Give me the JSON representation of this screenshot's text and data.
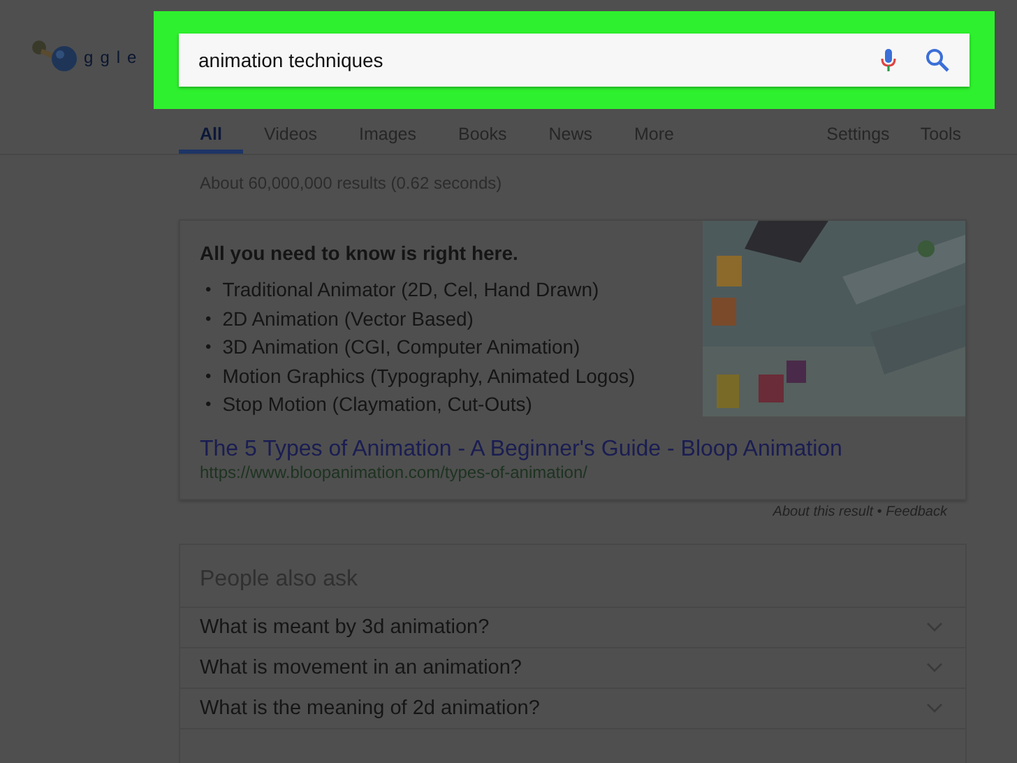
{
  "logo": {
    "letters": [
      "g",
      "g",
      "l",
      "e"
    ]
  },
  "search": {
    "value": "animation techniques",
    "highlighted": true
  },
  "tabs": [
    {
      "label": "All",
      "selected": true
    },
    {
      "label": "Videos",
      "selected": false
    },
    {
      "label": "Images",
      "selected": false
    },
    {
      "label": "Books",
      "selected": false
    },
    {
      "label": "News",
      "selected": false
    },
    {
      "label": "More",
      "selected": false
    }
  ],
  "tools": [
    "Settings",
    "Tools"
  ],
  "result_stats": "About 60,000,000 results (0.62 seconds)",
  "featured": {
    "heading": "All you need to know is right here.",
    "bullet": "•",
    "items": [
      "Traditional Animator (2D, Cel, Hand Drawn)",
      "2D Animation (Vector Based)",
      "3D Animation (CGI, Computer Animation)",
      "Motion Graphics (Typography, Animated Logos)",
      "Stop Motion (Claymation, Cut-Outs)"
    ],
    "image": {
      "kind": "picture"
    },
    "link_title": "The 5 Types of Animation - A Beginner's Guide - Bloop Animation",
    "url": "https://www.bloopanimation.com/types-of-animation/"
  },
  "feedback": {
    "about": "About this result",
    "separator": "•",
    "feedback": "Feedback"
  },
  "people_also_ask": {
    "title": "People also ask",
    "questions": [
      {
        "text": "What is meant by 3d animation?",
        "expanded": false
      },
      {
        "text": "What is movement in an animation?",
        "expanded": false
      },
      {
        "text": "What is the meaning of 2d animation?",
        "expanded": false
      }
    ]
  }
}
